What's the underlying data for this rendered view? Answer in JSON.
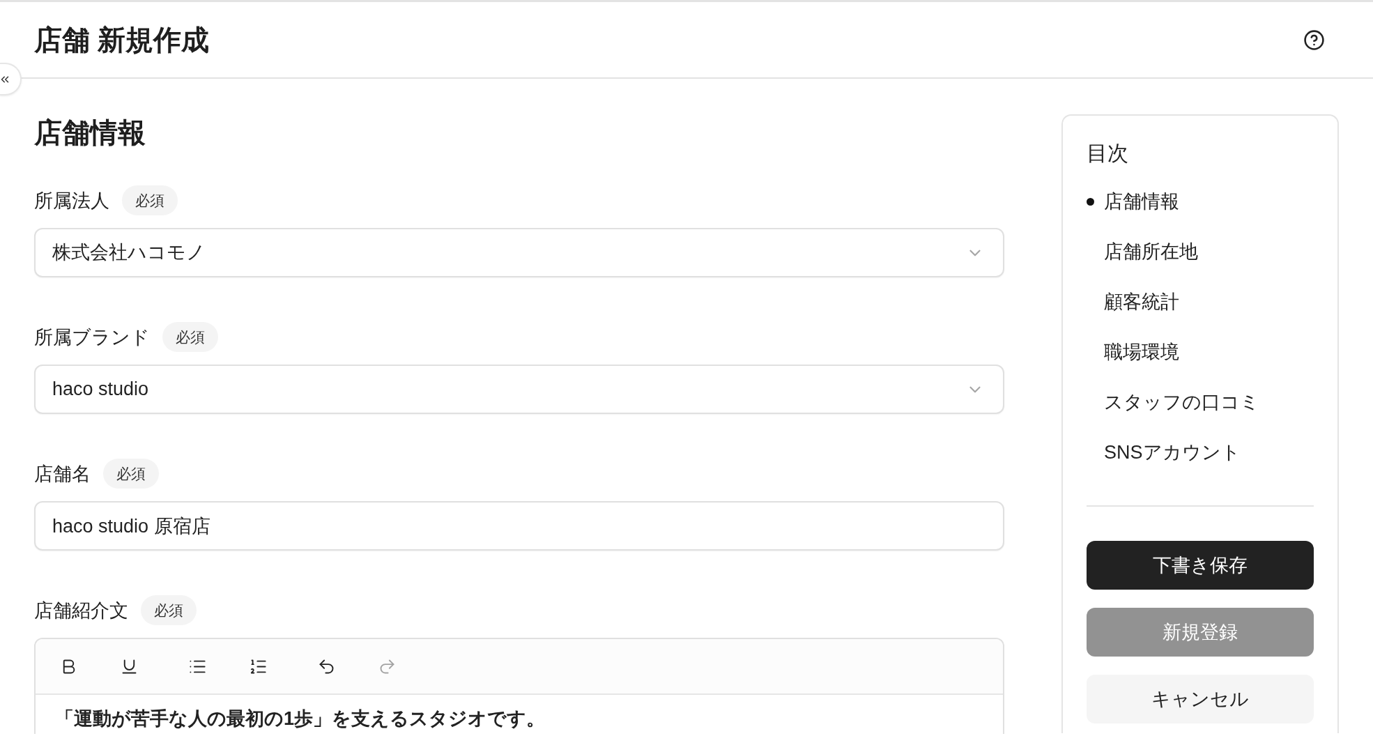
{
  "header": {
    "title": "店舗 新規作成"
  },
  "section": {
    "title": "店舗情報"
  },
  "fields": [
    {
      "kind": "select",
      "label": "所属法人",
      "badge": "必須",
      "value": "株式会社ハコモノ"
    },
    {
      "kind": "select",
      "label": "所属ブランド",
      "badge": "必須",
      "value": "haco studio"
    },
    {
      "kind": "text",
      "label": "店舗名",
      "badge": "必須",
      "value": "haco studio 原宿店"
    },
    {
      "kind": "rich_text",
      "label": "店舗紹介文",
      "badge": "必須",
      "toolbar": {
        "groups": [
          {
            "buttons": [
              {
                "kind": "bold",
                "disabled": false
              },
              {
                "kind": "underline",
                "disabled": false
              }
            ]
          },
          {
            "buttons": [
              {
                "kind": "bullet_list",
                "disabled": false
              },
              {
                "kind": "ordered_list",
                "disabled": false
              }
            ]
          },
          {
            "buttons": [
              {
                "kind": "undo",
                "disabled": false
              },
              {
                "kind": "redo",
                "disabled": true
              }
            ]
          }
        ]
      },
      "value": "「運動が苦手な人の最初の1歩」を支えるスタジオです。"
    }
  ],
  "toc": {
    "title": "目次",
    "items": [
      {
        "label": "店舗情報",
        "selected": true
      },
      {
        "label": "店舗所在地",
        "selected": false
      },
      {
        "label": "顧客統計",
        "selected": false
      },
      {
        "label": "職場環境",
        "selected": false
      },
      {
        "label": "スタッフの口コミ",
        "selected": false
      },
      {
        "label": "SNSアカウント",
        "selected": false
      }
    ]
  },
  "actions": [
    {
      "kind": "primary",
      "label": "下書き保存",
      "disabled": false
    },
    {
      "kind": "primary",
      "label": "新規登録",
      "disabled": true
    },
    {
      "kind": "neutral",
      "label": "キャンセル",
      "disabled": false
    }
  ]
}
